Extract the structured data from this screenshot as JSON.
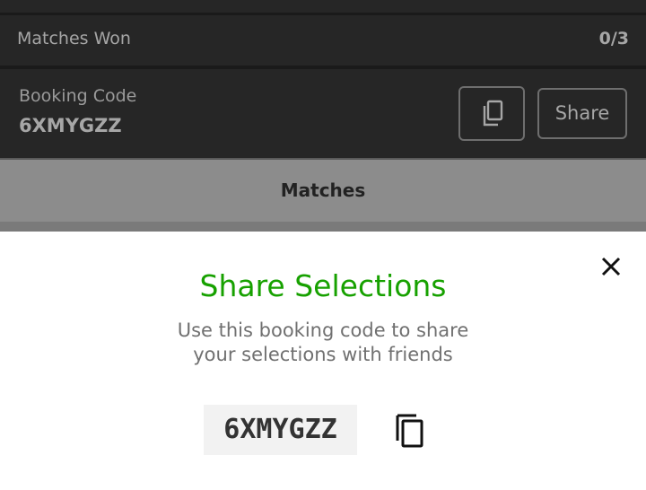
{
  "summary": {
    "matches_won_label": "Matches Won",
    "matches_won_value": "0/3",
    "booking_code_label": "Booking Code",
    "booking_code_value": "6XMYGZZ",
    "share_label": "Share"
  },
  "tabs": [
    {
      "label": "Matches"
    }
  ],
  "modal": {
    "title": "Share Selections",
    "description_line1": "Use this booking code to share",
    "description_line2": "your selections with friends",
    "code": "6XMYGZZ"
  },
  "colors": {
    "accent_green": "#17a100",
    "dark_panel": "#262626",
    "tab_gray": "#8c8c8c"
  },
  "icons": [
    "copy-icon",
    "close-icon"
  ]
}
